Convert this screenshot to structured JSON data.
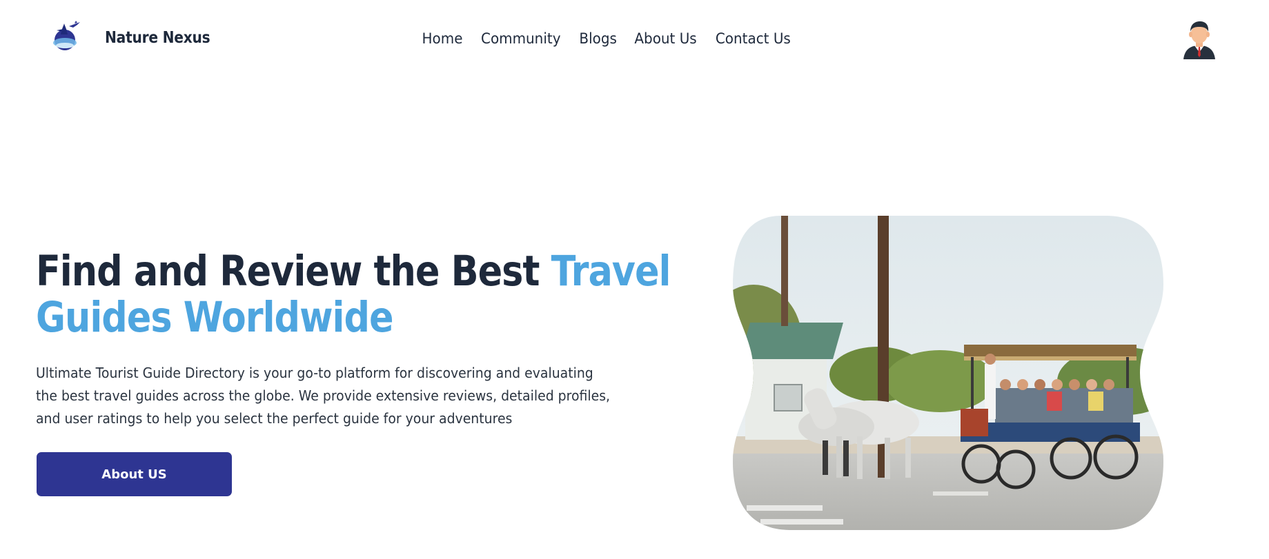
{
  "brand": {
    "name": "Nature Nexus",
    "logo_icon": "globe-airplane-logo-icon"
  },
  "nav": {
    "items": [
      {
        "label": "Home"
      },
      {
        "label": "Community"
      },
      {
        "label": "Blogs"
      },
      {
        "label": "About Us"
      },
      {
        "label": "Contact Us"
      }
    ]
  },
  "user": {
    "avatar_icon": "user-avatar-icon"
  },
  "hero": {
    "title_part1": "Find and Review the Best ",
    "title_highlight1": "Travel",
    "title_highlight2": "Guides Worldwide",
    "description_lines": [
      "Ultimate Tourist Guide Directory is your go-to platform for discovering and evaluating",
      "the best travel guides across the globe. We provide extensive reviews, detailed profiles,",
      "and user ratings to help you select the perfect guide for your adventures"
    ],
    "button_label": "About US",
    "image_icon": "horse-carriage-tour-photo"
  },
  "colors": {
    "dark_text": "#1e293b",
    "highlight": "#4ea5df",
    "button_bg": "#2e3592",
    "background": "#ffffff"
  }
}
